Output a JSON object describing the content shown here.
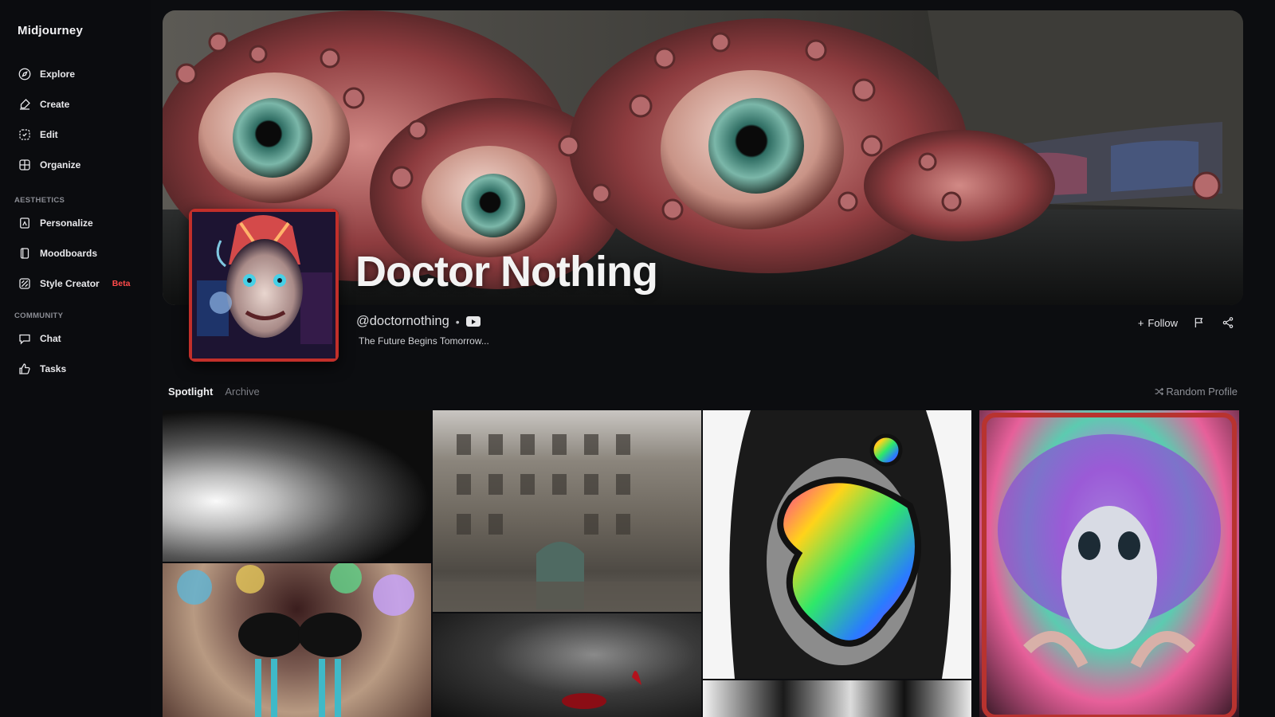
{
  "app": {
    "name": "Midjourney"
  },
  "sidebar": {
    "main": [
      {
        "label": "Explore",
        "icon": "compass-icon"
      },
      {
        "label": "Create",
        "icon": "brush-icon"
      },
      {
        "label": "Edit",
        "icon": "edit-icon"
      },
      {
        "label": "Organize",
        "icon": "grid-icon"
      }
    ],
    "aesthetics_label": "AESTHETICS",
    "aesthetics": [
      {
        "label": "Personalize",
        "icon": "personalize-icon"
      },
      {
        "label": "Moodboards",
        "icon": "moodboard-icon"
      },
      {
        "label": "Style Creator",
        "icon": "style-creator-icon",
        "badge": "Beta"
      }
    ],
    "community_label": "COMMUNITY",
    "community": [
      {
        "label": "Chat",
        "icon": "chat-icon"
      },
      {
        "label": "Tasks",
        "icon": "thumbs-up-icon"
      }
    ]
  },
  "profile": {
    "name": "Doctor Nothing",
    "handle": "@doctornothing",
    "separator": "•",
    "tagline": "The Future Begins Tomorrow...",
    "follow_label": "Follow"
  },
  "tabs": [
    {
      "label": "Spotlight",
      "active": true
    },
    {
      "label": "Archive",
      "active": false
    }
  ],
  "random_profile_label": "Random Profile",
  "colors": {
    "background": "#0c0d10",
    "beta_badge": "#ff4b4b",
    "muted_text": "#7c7e85"
  }
}
